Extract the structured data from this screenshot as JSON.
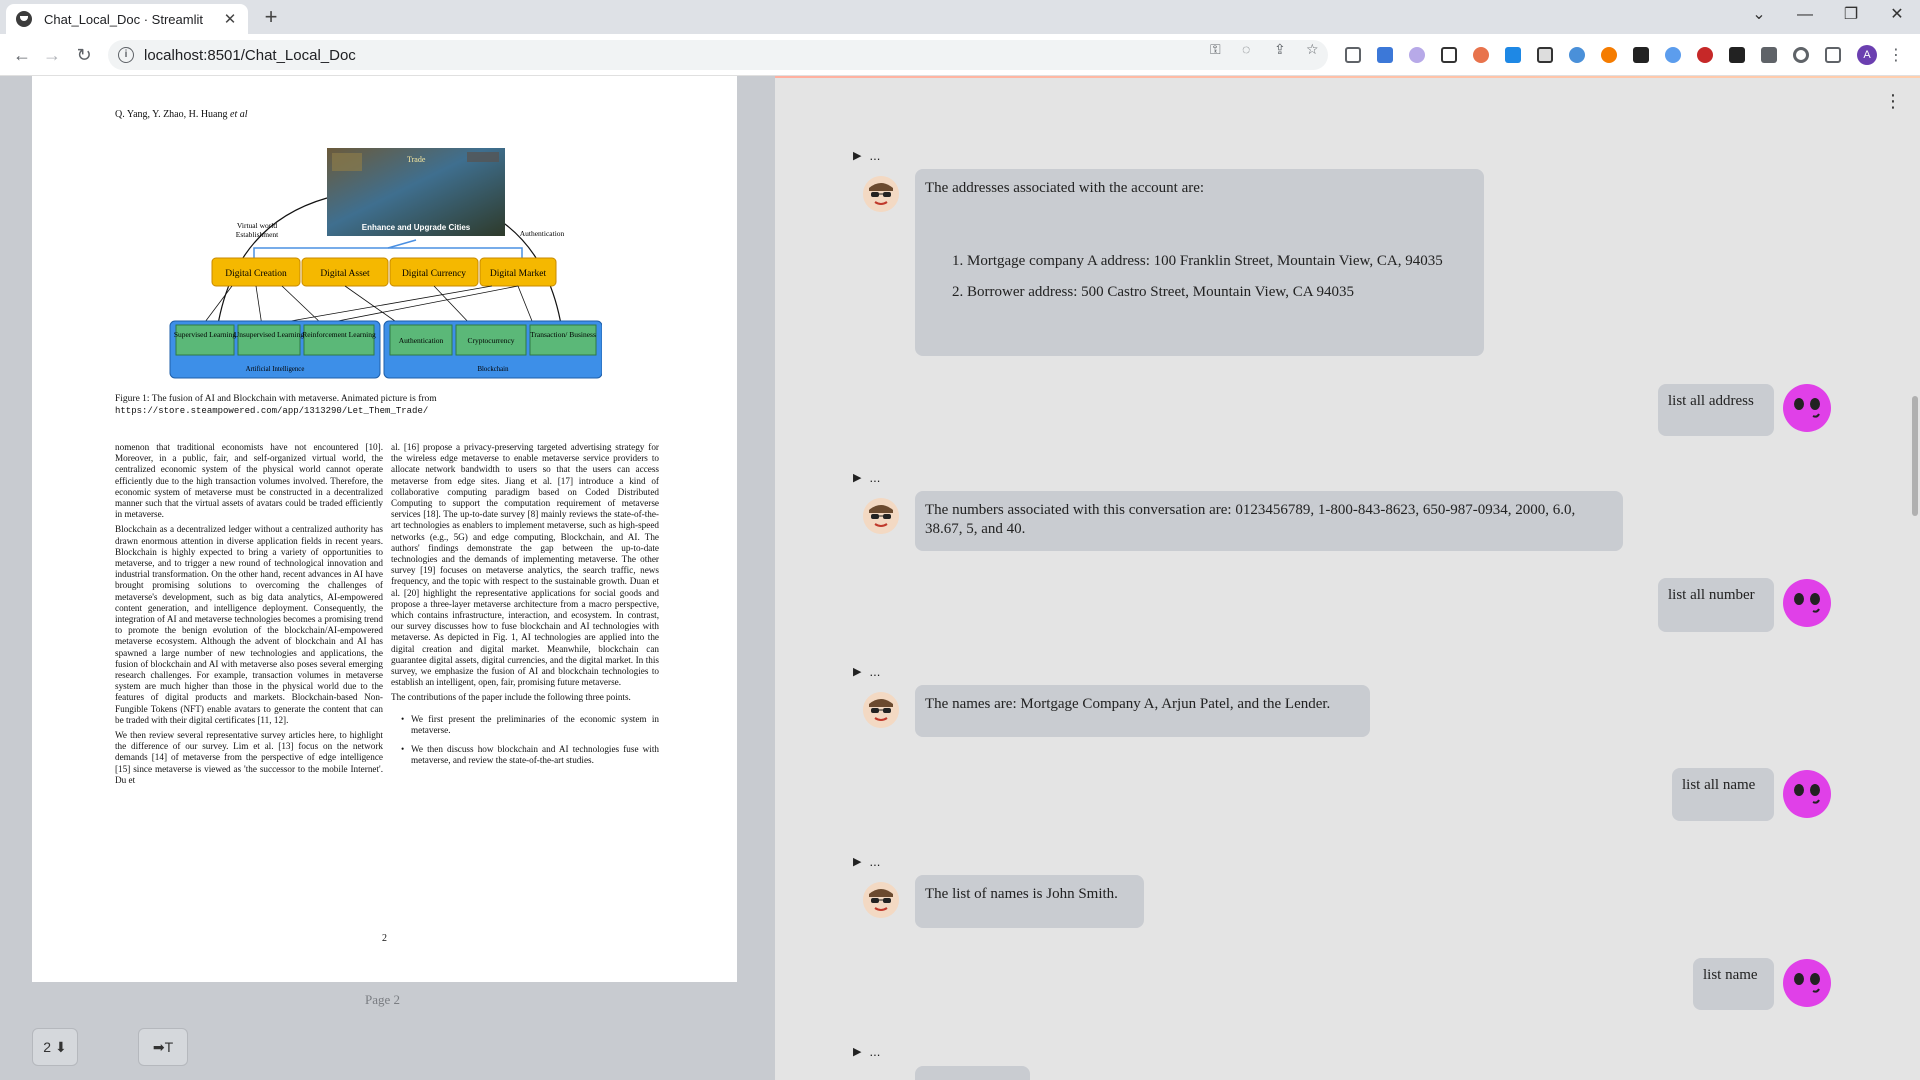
{
  "browser": {
    "tab_title": "Chat_Local_Doc · Streamlit",
    "url": "localhost:8501/Chat_Local_Doc",
    "profile_initial": "A"
  },
  "pdf": {
    "authors": "Q. Yang, Y. Zhao, H. Huang",
    "authors_suffix": "et al",
    "figure": {
      "image_top": "Trade",
      "image_caption": "Enhance and Upgrade Cities",
      "left_label_1": "Virtual world",
      "left_label_2": "Establishment",
      "right_label": "Authentication",
      "boxes": [
        "Digital Creation",
        "Digital Asset",
        "Digital Currency",
        "Digital Market"
      ],
      "ai_items": [
        "Supervised Learning",
        "Unsupervised Learning",
        "Reinforcement Learning"
      ],
      "ai_group": "Artificial Intelligence",
      "bc_items": [
        "Authentication",
        "Cryptocurrency",
        "Transaction/ Business"
      ],
      "bc_group": "Blockchain"
    },
    "caption": "Figure 1: The fusion of AI and Blockchain with metaverse. Animated picture is from",
    "caption_url": "https://store.steampowered.com/app/1313290/Let_Them_Trade/",
    "col_left": [
      "nomenon that traditional economists have not encountered [10]. Moreover, in a public, fair, and self-organized virtual world, the centralized economic system of the physical world cannot operate efficiently due to the high transaction volumes involved. Therefore, the economic system of metaverse must be constructed in a decentralized manner such that the virtual assets of avatars could be traded efficiently in metaverse.",
      "Blockchain as a decentralized ledger without a centralized authority has drawn enormous attention in diverse application fields in recent years. Blockchain is highly expected to bring a variety of opportunities to metaverse, and to trigger a new round of technological innovation and industrial transformation. On the other hand, recent advances in AI have brought promising solutions to overcoming the challenges of metaverse's development, such as big data analytics, AI-empowered content generation, and intelligence deployment. Consequently, the integration of AI and metaverse technologies becomes a promising trend to promote the benign evolution of the blockchain/AI-empowered metaverse ecosystem. Although the advent of blockchain and AI has spawned a large number of new technologies and applications, the fusion of blockchain and AI with metaverse also poses several emerging research challenges. For example, transaction volumes in metaverse system are much higher than those in the physical world due to the features of digital products and markets. Blockchain-based Non-Fungible Tokens (NFT) enable avatars to generate the content that can be traded with their digital certificates [11, 12].",
      "We then review several representative survey articles here, to highlight the difference of our survey. Lim et al. [13] focus on the network demands [14] of metaverse from the perspective of edge intelligence [15] since metaverse is viewed as 'the successor to the mobile Internet'. Du et"
    ],
    "col_right": [
      "al. [16] propose a privacy-preserving targeted advertising strategy for the wireless edge metaverse to enable metaverse service providers to allocate network bandwidth to users so that the users can access metaverse from edge sites. Jiang et al. [17] introduce a kind of collaborative computing paradigm based on Coded Distributed Computing to support the computation requirement of metaverse services [18]. The up-to-date survey [8] mainly reviews the state-of-the-art technologies as enablers to implement metaverse, such as high-speed networks (e.g., 5G) and edge computing, Blockchain, and AI. The authors' findings demonstrate the gap between the up-to-date technologies and the demands of implementing metaverse. The other survey [19] focuses on metaverse analytics, the search traffic, news frequency, and the topic with respect to the sustainable growth. Duan et al. [20] highlight the representative applications for social goods and propose a three-layer metaverse architecture from a macro perspective, which contains infrastructure, interaction, and ecosystem. In contrast, our survey discusses how to fuse blockchain and AI technologies with metaverse. As depicted in Fig. 1, AI technologies are applied into the digital creation and digital market. Meanwhile, blockchain can guarantee digital assets, digital currencies, and the digital market. In this survey, we emphasize the fusion of AI and blockchain technologies to establish an intelligent, open, fair, promising future metaverse.",
      "The contributions of the paper include the following three points."
    ],
    "bullets": [
      "We first present the preliminaries of the economic system in metaverse.",
      "We then discuss how blockchain and AI technologies fuse with metaverse, and review the state-of-the-art studies."
    ],
    "page_number": "2",
    "page_label": "Page 2",
    "page_select": "2 ⬇",
    "text_mode": "➡T"
  },
  "chat": {
    "expander_label": "...",
    "messages": [
      {
        "role": "bot",
        "intro": "The addresses associated with the account are:",
        "items": [
          "Mortgage company A address: 100 Franklin Street, Mountain View, CA, 94035",
          "Borrower address: 500 Castro Street, Mountain View, CA 94035"
        ]
      },
      {
        "role": "user",
        "text": "list all address"
      },
      {
        "role": "bot",
        "text": "The numbers associated with this conversation are: 0123456789, 1-800-843-8623, 650-987-0934, 2000, 6.0, 38.67, 5, and 40."
      },
      {
        "role": "user",
        "text": "list all number"
      },
      {
        "role": "bot",
        "text": "The names are: Mortgage Company A, Arjun Patel, and the Lender."
      },
      {
        "role": "user",
        "text": "list all name"
      },
      {
        "role": "bot",
        "text": "The list of names is John Smith."
      },
      {
        "role": "user",
        "text": "list name"
      }
    ]
  },
  "colors": {
    "user_avatar": "#e040e8",
    "digital_box": "#f5b800",
    "group_box": "#3d8fe8",
    "item_box": "#5bb878"
  }
}
